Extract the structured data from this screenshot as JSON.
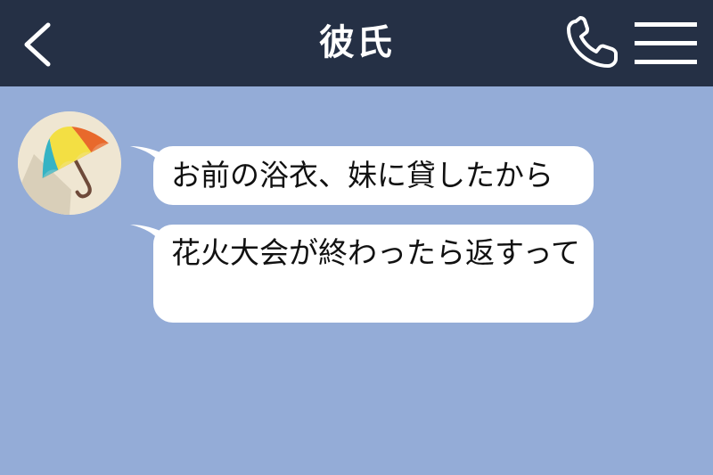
{
  "header": {
    "title": "彼氏",
    "back_icon": "chevron-left-icon",
    "call_icon": "phone-icon",
    "menu_icon": "hamburger-menu-icon"
  },
  "contact": {
    "avatar_icon": "umbrella-icon"
  },
  "messages": [
    {
      "text": "お前の浴衣、妹に貸したから"
    },
    {
      "text": "花火大会が終わったら返すって"
    }
  ],
  "colors": {
    "header_bg": "#253045",
    "chat_bg": "#94acd7",
    "bubble_bg": "#ffffff"
  }
}
